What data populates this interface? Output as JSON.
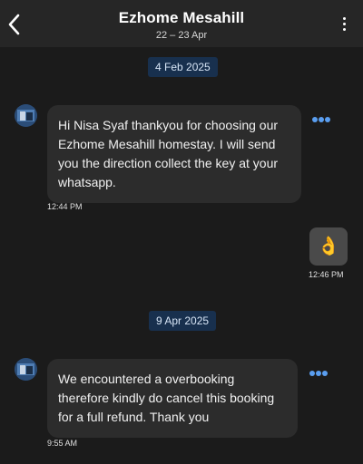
{
  "header": {
    "title": "Ezhome Mesahill",
    "dates": "22 – 23 Apr"
  },
  "messages": [
    {
      "date_label": "4 Feb 2025",
      "sender": "host",
      "text": "Hi Nisa Syaf thankyou for choosing our Ezhome Mesahill homestay. I will send you the direction collect the key at your whatsapp.",
      "time": "12:44 PM"
    },
    {
      "sender": "me",
      "text": "👌",
      "time": "12:46 PM"
    },
    {
      "date_label": "9 Apr 2025",
      "sender": "host",
      "text": "We encountered a overbooking therefore kindly do cancel this booking for a full refund. Thank you",
      "time": "9:55 AM"
    }
  ],
  "icons": {
    "back": "chevron-left-icon",
    "more": "vertical-ellipsis-icon",
    "message_options": "horizontal-ellipsis-icon"
  },
  "colors": {
    "background": "#1b1b1b",
    "header": "#262626",
    "bubble": "#2c2c2c",
    "date_chip": "#18304e",
    "accent": "#5a9ef0"
  }
}
